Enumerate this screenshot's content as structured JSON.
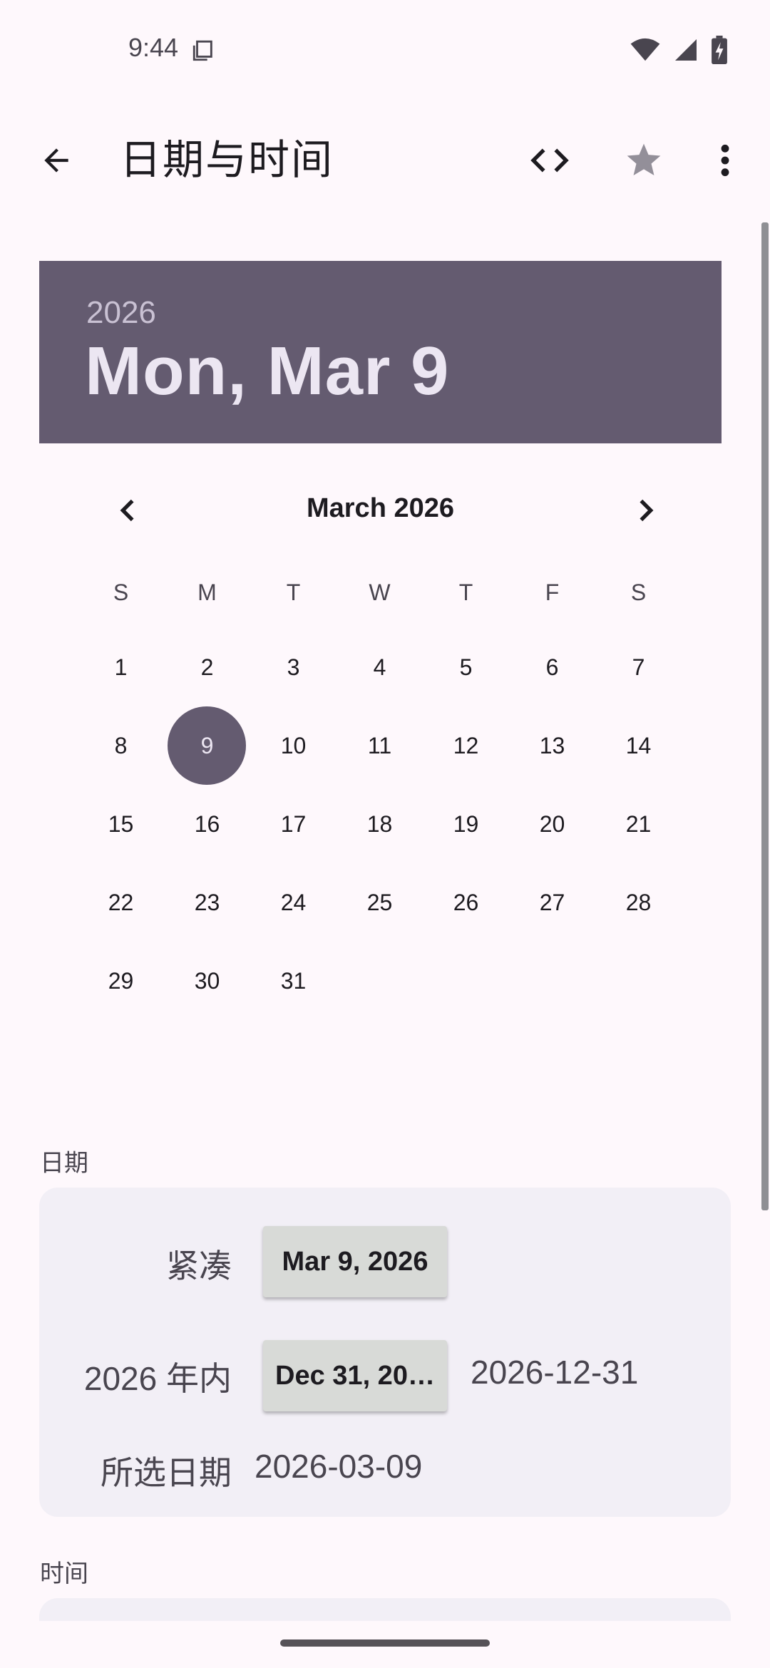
{
  "status": {
    "time": "9:44"
  },
  "app_bar": {
    "title": "日期与时间"
  },
  "date_header": {
    "year": "2026",
    "date": "Mon, Mar 9"
  },
  "calendar": {
    "month_label": "March 2026",
    "weekdays": [
      "S",
      "M",
      "T",
      "W",
      "T",
      "F",
      "S"
    ],
    "weeks": [
      [
        "1",
        "2",
        "3",
        "4",
        "5",
        "6",
        "7"
      ],
      [
        "8",
        "9",
        "10",
        "11",
        "12",
        "13",
        "14"
      ],
      [
        "15",
        "16",
        "17",
        "18",
        "19",
        "20",
        "21"
      ],
      [
        "22",
        "23",
        "24",
        "25",
        "26",
        "27",
        "28"
      ],
      [
        "29",
        "30",
        "31",
        "",
        "",
        "",
        ""
      ]
    ],
    "selected_day": "9",
    "accent_color": "#645b70"
  },
  "date_section": {
    "label": "日期",
    "compact_label": "紧凑",
    "compact_button": "Mar 9, 2026",
    "within_year_label": "2026 年内",
    "within_year_button": "Dec 31, 20…",
    "within_year_value": "2026-12-31",
    "selected_label": "所选日期",
    "selected_value": "2026-03-09"
  },
  "time_section": {
    "label": "时间"
  }
}
